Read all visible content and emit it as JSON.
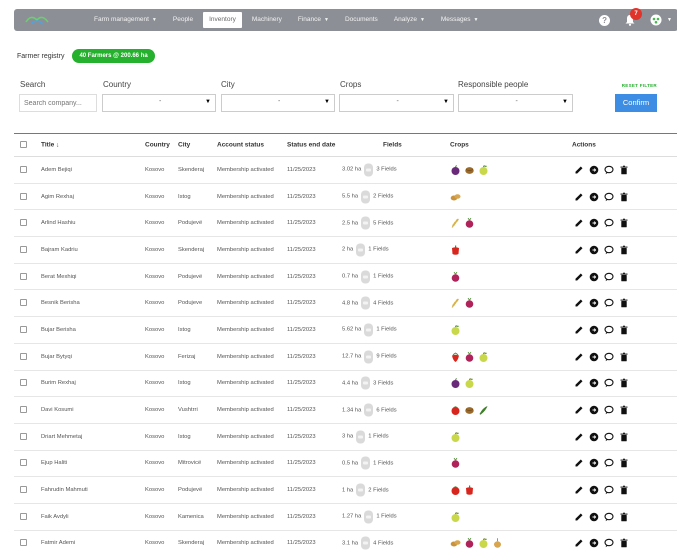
{
  "nav": {
    "items": [
      {
        "label": "Farm management",
        "caret": true,
        "active": false
      },
      {
        "label": "People",
        "caret": false,
        "active": false
      },
      {
        "label": "Inventory",
        "caret": false,
        "active": true
      },
      {
        "label": "Machinery",
        "caret": false,
        "active": false
      },
      {
        "label": "Finance",
        "caret": true,
        "active": false
      },
      {
        "label": "Documents",
        "caret": false,
        "active": false
      },
      {
        "label": "Analyze",
        "caret": true,
        "active": false
      },
      {
        "label": "Messages",
        "caret": true,
        "active": false
      }
    ],
    "help": "?",
    "notification_count": "7",
    "colors": {
      "bar": "#8c8f96",
      "badge": "#e0342a"
    }
  },
  "registry": {
    "title": "Farmer registry",
    "pill": "40 Farmers @ 200.66 ha"
  },
  "filters": {
    "search_label": "Search",
    "search_placeholder": "Search company...",
    "country_label": "Country",
    "city_label": "City",
    "crops_label": "Crops",
    "responsible_label": "Responsible people",
    "select_value": "-",
    "reset": "RESET FILTER",
    "confirm": "Confirm"
  },
  "table": {
    "headers": {
      "title": "Title ↓",
      "country": "Country",
      "city": "City",
      "status": "Account status",
      "end_date": "Status end date",
      "fields": "Fields",
      "crops": "Crops",
      "actions": "Actions"
    },
    "rows": [
      {
        "name": "Adem Bejiqi",
        "country": "Kosovo",
        "city": "Skenderaj",
        "status": "Membership activated",
        "date": "11/25/2023",
        "ha": "3.02 ha",
        "fields": "3  Fields",
        "crops": [
          "plum-icon",
          "walnut-icon",
          "apple-icon"
        ]
      },
      {
        "name": "Agim Rexhaj",
        "country": "Kosovo",
        "city": "Istog",
        "status": "Membership activated",
        "date": "11/25/2023",
        "ha": "5.5 ha",
        "fields": "2  Fields",
        "crops": [
          "potato-icon"
        ]
      },
      {
        "name": "Arlind Hashiu",
        "country": "Kosovo",
        "city": "Podujevë",
        "status": "Membership activated",
        "date": "11/25/2023",
        "ha": "2.5 ha",
        "fields": "5  Fields",
        "crops": [
          "wheat-icon",
          "beet-icon"
        ]
      },
      {
        "name": "Bajram Kadriu",
        "country": "Kosovo",
        "city": "Skenderaj",
        "status": "Membership activated",
        "date": "11/25/2023",
        "ha": "2 ha",
        "fields": "1  Fields",
        "crops": [
          "pepper-icon"
        ]
      },
      {
        "name": "Berat Mexhiqi",
        "country": "Kosovo",
        "city": "Podujevë",
        "status": "Membership activated",
        "date": "11/25/2023",
        "ha": "0.7 ha",
        "fields": "1  Fields",
        "crops": [
          "beet-icon"
        ]
      },
      {
        "name": "Besnik Berisha",
        "country": "Kosovo",
        "city": "Podujeve",
        "status": "Membership activated",
        "date": "11/25/2023",
        "ha": "4.8 ha",
        "fields": "4  Fields",
        "crops": [
          "wheat-icon",
          "beet-icon"
        ]
      },
      {
        "name": "Bujar Berisha",
        "country": "Kosovo",
        "city": "Istog",
        "status": "Membership activated",
        "date": "11/25/2023",
        "ha": "5.62 ha",
        "fields": "1  Fields",
        "crops": [
          "apple-icon"
        ]
      },
      {
        "name": "Bujar Bytyqi",
        "country": "Kosovo",
        "city": "Ferizaj",
        "status": "Membership activated",
        "date": "11/25/2023",
        "ha": "12.7 ha",
        "fields": "9  Fields",
        "crops": [
          "strawberry-icon",
          "beet-icon",
          "apple-icon"
        ]
      },
      {
        "name": "Burim Rexhaj",
        "country": "Kosovo",
        "city": "Istog",
        "status": "Membership activated",
        "date": "11/25/2023",
        "ha": "4.4 ha",
        "fields": "3  Fields",
        "crops": [
          "plum-icon",
          "apple-icon"
        ]
      },
      {
        "name": "Davi Kosumi",
        "country": "Kosovo",
        "city": "Vushtrri",
        "status": "Membership activated",
        "date": "11/25/2023",
        "ha": "1.34 ha",
        "fields": "6  Fields",
        "crops": [
          "tomato-icon",
          "walnut-icon",
          "cucumber-icon"
        ]
      },
      {
        "name": "Driart Mehmetaj",
        "country": "Kosovo",
        "city": "Istog",
        "status": "Membership activated",
        "date": "11/25/2023",
        "ha": "3 ha",
        "fields": "1  Fields",
        "crops": [
          "apple-icon"
        ]
      },
      {
        "name": "Ejup Haliti",
        "country": "Kosovo",
        "city": "Mitrovicë",
        "status": "Membership activated",
        "date": "11/25/2023",
        "ha": "0.5 ha",
        "fields": "1  Fields",
        "crops": [
          "beet-icon"
        ]
      },
      {
        "name": "Fahrudin Mahmuti",
        "country": "Kosovo",
        "city": "Podujevë",
        "status": "Membership activated",
        "date": "11/25/2023",
        "ha": "1 ha",
        "fields": "2  Fields",
        "crops": [
          "tomato-icon",
          "pepper-icon"
        ]
      },
      {
        "name": "Faik Avdyli",
        "country": "Kosovo",
        "city": "Kamenica",
        "status": "Membership activated",
        "date": "11/25/2023",
        "ha": "1.27 ha",
        "fields": "1  Fields",
        "crops": [
          "apple-icon"
        ]
      },
      {
        "name": "Fatmir Ademi",
        "country": "Kosovo",
        "city": "Skenderaj",
        "status": "Membership activated",
        "date": "11/25/2023",
        "ha": "3.1 ha",
        "fields": "4  Fields",
        "crops": [
          "potato-icon",
          "beet-icon",
          "apple-icon",
          "onion-icon"
        ]
      }
    ]
  }
}
